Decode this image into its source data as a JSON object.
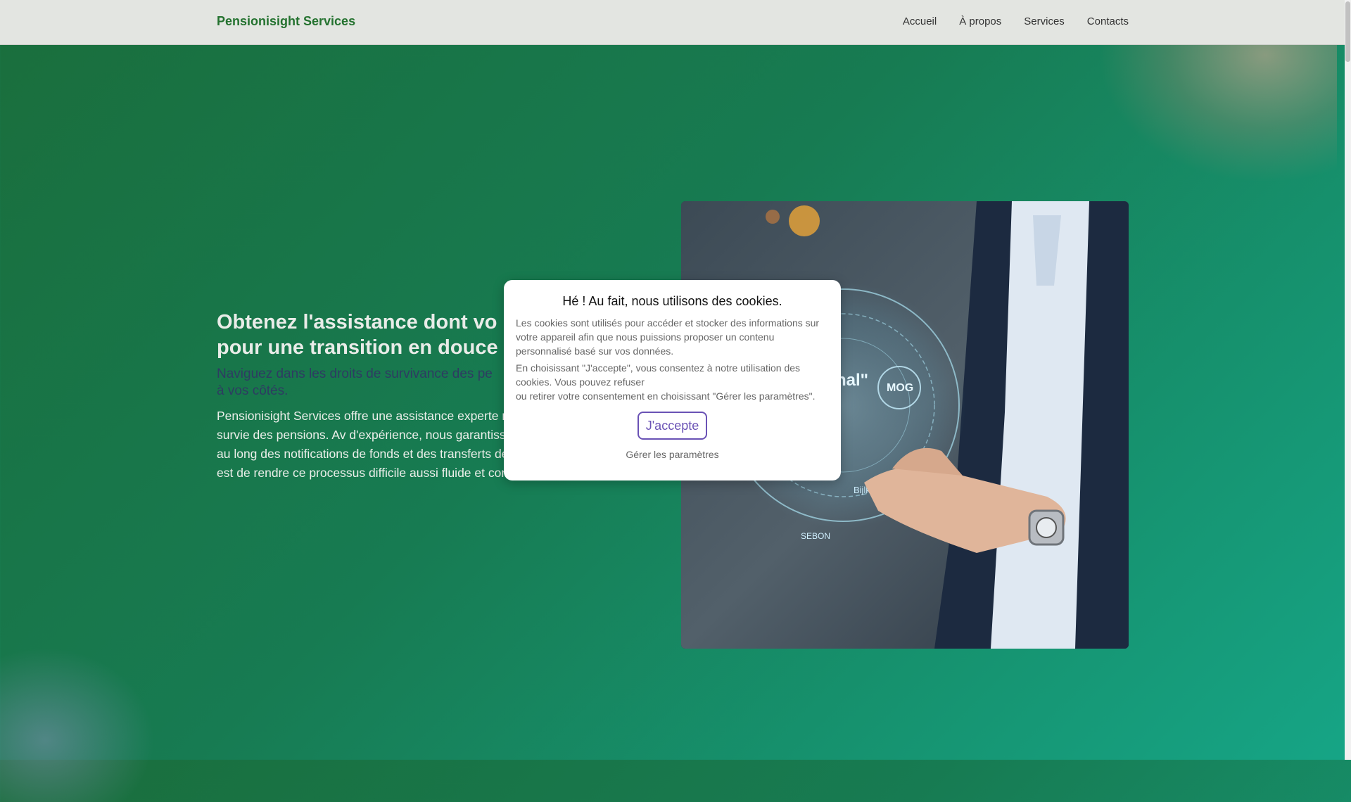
{
  "nav": {
    "brand": "Pensionisight Services",
    "links": [
      "Accueil",
      "À propos",
      "Services",
      "Contacts"
    ]
  },
  "hero": {
    "title_line1": "Obtenez l'assistance dont vo",
    "title_line2": "pour une transition en douce",
    "subtitle_line1": "Naviguez dans les droits de survivance des pe",
    "subtitle_line2": "à vos côtés.",
    "body": "Pensionisight Services offre une assistance experte naviguer dans les droits de survie des pensions. Av d'expérience, nous garantissons un service d'accom tout au long des notifications de fonds et des transferts de paiements. Notre mission est de rendre ce processus difficile aussi fluide et compréhensible que possible.",
    "image_alt": "Homme présentant une interface holographique"
  },
  "cookie": {
    "title": "Hé ! Au fait, nous utilisons des cookies.",
    "text1": "Les cookies sont utilisés pour accéder et stocker des informations sur votre appareil afin que nous puissions proposer un contenu personnalisé basé sur vos données.",
    "text2_line1": "En choisissant \"J'accepte\", vous consentez à notre utilisation des cookies. Vous pouvez refuser",
    "text2_line2": "ou retirer votre consentement en choisissant \"Gérer les paramètres\".",
    "accept_label": "J'accepte",
    "settings_label": "Gérer les paramètres"
  },
  "hologram_labels": [
    "MOG",
    "nal\"",
    "Bijlki",
    "SEBON"
  ],
  "colors": {
    "brand": "#24722f",
    "accent_button": "#6a52b5",
    "background_start": "#1a6e3c",
    "background_end": "#16a586"
  }
}
